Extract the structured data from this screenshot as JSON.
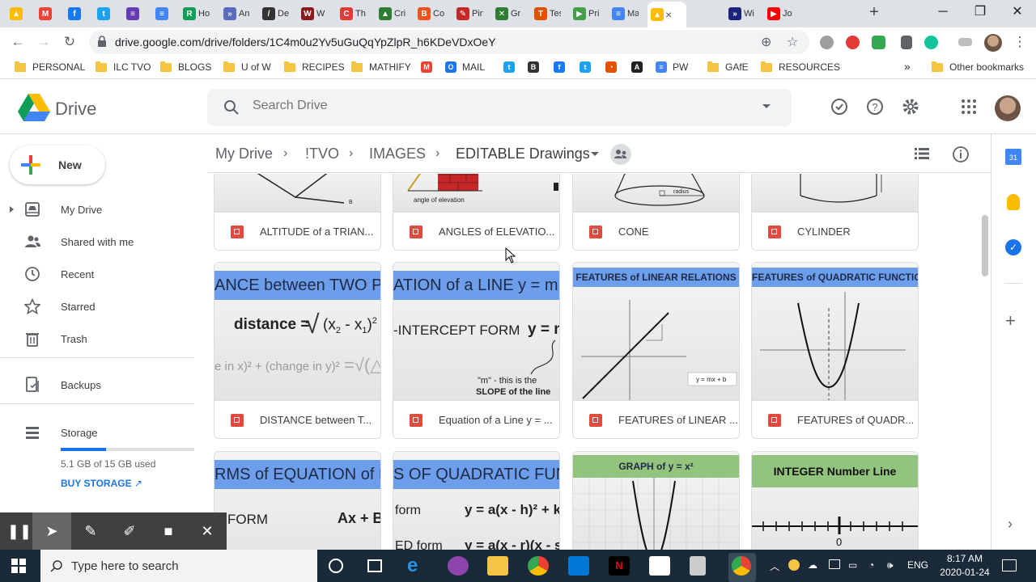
{
  "browser": {
    "tabs": [
      {
        "label": "",
        "color": "#fbbc04",
        "glyph": "▲"
      },
      {
        "label": "",
        "color": "#ea4335",
        "glyph": "M"
      },
      {
        "label": "",
        "color": "#1877f2",
        "glyph": "f"
      },
      {
        "label": "",
        "color": "#1da1f2",
        "glyph": "t"
      },
      {
        "label": "",
        "color": "#673ab7",
        "glyph": "≡"
      },
      {
        "label": "",
        "color": "#4285f4",
        "glyph": "≡"
      },
      {
        "label": "Ho",
        "color": "#0f9d58",
        "glyph": "R"
      },
      {
        "label": "An",
        "color": "#5c6bc0",
        "glyph": "»"
      },
      {
        "label": "De",
        "color": "#333333",
        "glyph": "/"
      },
      {
        "label": "W",
        "color": "#8b1a1a",
        "glyph": "W"
      },
      {
        "label": "Th",
        "color": "#e53935",
        "glyph": "C"
      },
      {
        "label": "Cri",
        "color": "#2e7d32",
        "glyph": "▲"
      },
      {
        "label": "Co",
        "color": "#f4511e",
        "glyph": "B"
      },
      {
        "label": "Pin",
        "color": "#c62828",
        "glyph": "✎"
      },
      {
        "label": "Gr",
        "color": "#2e7d32",
        "glyph": "✕"
      },
      {
        "label": "Tes",
        "color": "#e65100",
        "glyph": "T"
      },
      {
        "label": "Pri",
        "color": "#43a047",
        "glyph": "▶"
      },
      {
        "label": "Ma",
        "color": "#4285f4",
        "glyph": "≡"
      },
      {
        "label": "",
        "color": "#fbbc04",
        "glyph": "▲"
      },
      {
        "label": "Wi",
        "color": "#1a237e",
        "glyph": "»"
      },
      {
        "label": "Jo",
        "color": "#ff0000",
        "glyph": "▶"
      }
    ],
    "active_close": "×",
    "new_tab": "+",
    "minimize": "─",
    "restore": "❐",
    "close": "✕",
    "url": "drive.google.com/drive/folders/1C4m0u2Yv5uGuQqYpZlpR_h6KDeVDxOeY"
  },
  "bookmarks": [
    {
      "label": "PERSONAL",
      "type": "folder"
    },
    {
      "label": "ILC TVO",
      "type": "folder"
    },
    {
      "label": "BLOGS",
      "type": "folder"
    },
    {
      "label": "U of W",
      "type": "folder"
    },
    {
      "label": "RECIPES",
      "type": "folder"
    },
    {
      "label": "MATHIFY",
      "type": "folder"
    },
    {
      "label": "MAIL",
      "type": "site",
      "color": "#1a73e8",
      "glyph": "O"
    },
    {
      "label": "PW",
      "type": "site",
      "color": "#4285f4",
      "glyph": "≡"
    },
    {
      "label": "GAfE",
      "type": "folder"
    },
    {
      "label": "RESOURCES",
      "type": "folder"
    }
  ],
  "bookmarks_overflow": "»",
  "other_bookmarks": "Other bookmarks",
  "drive": {
    "logo_text": "Drive",
    "search_placeholder": "Search Drive",
    "new_label": "New",
    "nav": [
      {
        "label": "My Drive",
        "icon": "my-drive-icon"
      },
      {
        "label": "Shared with me",
        "icon": "shared-icon"
      },
      {
        "label": "Recent",
        "icon": "clock-icon"
      },
      {
        "label": "Starred",
        "icon": "star-icon"
      },
      {
        "label": "Trash",
        "icon": "trash-icon"
      },
      {
        "label": "Backups",
        "icon": "backup-icon"
      },
      {
        "label": "Storage",
        "icon": "storage-icon"
      }
    ],
    "storage_used": "5.1 GB of 15 GB used",
    "storage_fraction": 0.34,
    "buy_storage": "BUY STORAGE",
    "breadcrumb": [
      "My Drive",
      "!TVO",
      "IMAGES",
      "EDITABLE Drawings"
    ],
    "files": [
      {
        "name": "ALTITUDE of a TRIAN..."
      },
      {
        "name": "ANGLES of ELEVATIO..."
      },
      {
        "name": "CONE"
      },
      {
        "name": "CYLINDER"
      },
      {
        "name": "DISTANCE between T..."
      },
      {
        "name": "Equation of a Line y = ..."
      },
      {
        "name": "FEATURES of LINEAR ..."
      },
      {
        "name": "FEATURES of QUADR..."
      }
    ],
    "thumbs": {
      "angle_label": "angle of elevation",
      "radius": "radius",
      "distance_banner": "ANCE between TWO P",
      "distance_formula": "distance =",
      "distance_sub": "e in x)² + (change in y)²",
      "line_banner": "ATION of a LINE y = m",
      "line_sub": "-INTERCEPT FORM",
      "line_y": "y = m",
      "line_note1": "\"m\" - this is the",
      "line_note2": "SLOPE of the line",
      "linear_banner": "FEATURES of LINEAR RELATIONS",
      "linear_eq": "y = mx + b",
      "quad_banner": "FEATURES of QUADRATIC FUNCTIONS",
      "forms_banner": "RMS of EQUATION of LI",
      "forms_form": "FORM",
      "forms_eq": "Ax + By",
      "quadforms_banner": "S OF QUADRATIC FUNC",
      "quadforms_form1": "form",
      "quadforms_eq1": "y = a(x - h)² + k",
      "quadforms_form2": "ED form",
      "quadforms_eq2": "y = a(x - r)(x - s",
      "graph_banner": "GRAPH of y = x²",
      "integer_banner": "INTEGER Number Line",
      "integer_zero": "0"
    }
  },
  "taskbar": {
    "search_placeholder": "Type here to search",
    "lang": "ENG",
    "time": "8:17 AM",
    "date": "2020-01-24"
  }
}
